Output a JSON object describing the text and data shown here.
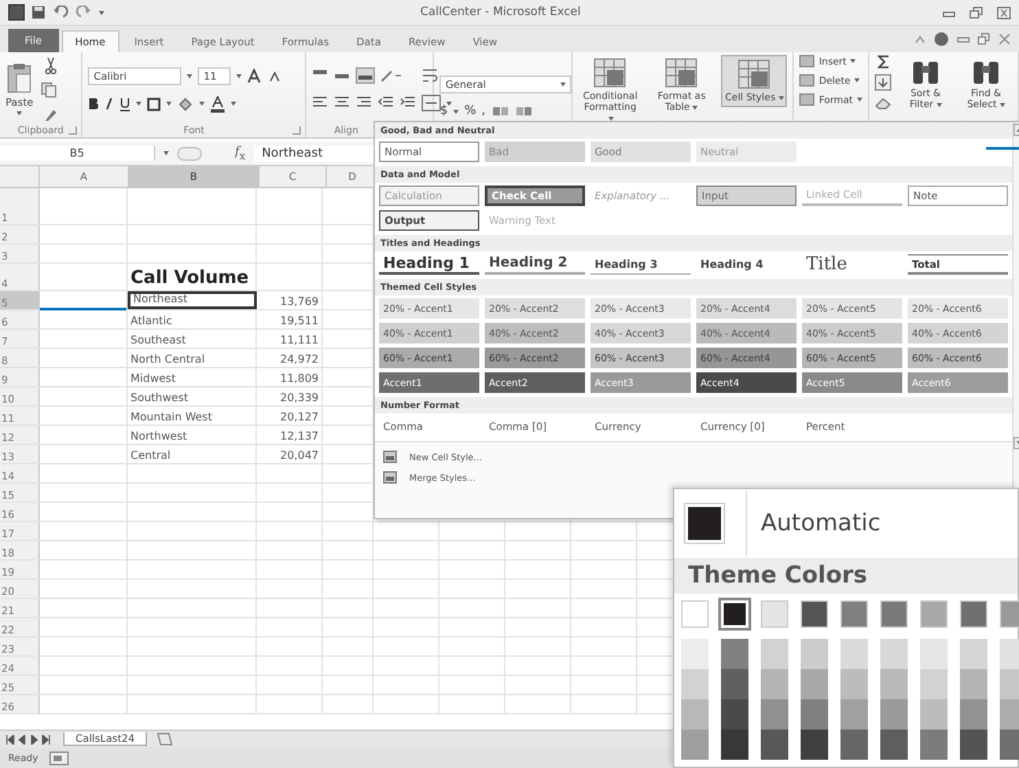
{
  "window": {
    "title": "CallCenter - Microsoft Excel"
  },
  "ribbon_tabs": [
    {
      "label": "File",
      "kind": "file",
      "selected": false
    },
    {
      "label": "Home",
      "kind": "tab",
      "selected": true
    },
    {
      "label": "Insert",
      "kind": "tab",
      "selected": false
    },
    {
      "label": "Page Layout",
      "kind": "tab",
      "selected": false
    },
    {
      "label": "Formulas",
      "kind": "tab",
      "selected": false
    },
    {
      "label": "Data",
      "kind": "tab",
      "selected": false
    },
    {
      "label": "Review",
      "kind": "tab",
      "selected": false
    },
    {
      "label": "View",
      "kind": "tab",
      "selected": false
    }
  ],
  "ribbon": {
    "clipboard": {
      "paste": "Paste",
      "label": "Clipboard"
    },
    "font": {
      "name": "Calibri",
      "size": "11",
      "label": "Font"
    },
    "alignment": {
      "label": "Align"
    },
    "number": {
      "format": "General",
      "symbols": [
        "$",
        "%",
        ","
      ]
    },
    "styles": [
      {
        "label": "Conditional Formatting",
        "selected": false
      },
      {
        "label": "Format as Table",
        "selected": false
      },
      {
        "label": "Cell Styles",
        "selected": true
      }
    ],
    "cells": [
      "Insert",
      "Delete",
      "Format"
    ],
    "editing": [
      "Sort & Filter",
      "Find & Select"
    ]
  },
  "formula_bar": {
    "name_box": "B5",
    "function_label": "*f*$_{x}$",
    "formula": "Northeast"
  },
  "sheet": {
    "columns": [
      {
        "label": "A",
        "selected": false
      },
      {
        "label": "B",
        "selected": true
      },
      {
        "label": "C",
        "selected": false
      },
      {
        "label": "D",
        "selected": false
      }
    ],
    "rows": [
      {
        "number": "1",
        "selected": false
      },
      {
        "number": "2",
        "selected": false
      },
      {
        "number": "3",
        "selected": false
      },
      {
        "number": "4",
        "kind": "title",
        "label": "Call Volume",
        "selected": false
      },
      {
        "number": "5",
        "label": "Northeast",
        "value": "13,769",
        "selected": true
      },
      {
        "number": "6",
        "label": "Atlantic",
        "value": "19,511",
        "selected": false
      },
      {
        "number": "7",
        "label": "Southeast",
        "value": "11,111",
        "selected": false
      },
      {
        "number": "8",
        "label": "North Central",
        "value": "24,972",
        "selected": false
      },
      {
        "number": "9",
        "label": "Midwest",
        "value": "11,809",
        "selected": false
      },
      {
        "number": "10",
        "label": "Southwest",
        "value": "20,339",
        "selected": false
      },
      {
        "number": "11",
        "label": "Mountain West",
        "value": "20,127",
        "selected": false
      },
      {
        "number": "12",
        "label": "Northwest",
        "value": "12,137",
        "selected": false
      },
      {
        "number": "13",
        "label": "Central",
        "value": "20,047",
        "selected": false
      },
      {
        "number": "14",
        "selected": false
      },
      {
        "number": "15",
        "selected": false
      },
      {
        "number": "16",
        "selected": false
      },
      {
        "number": "17",
        "selected": false
      },
      {
        "number": "18",
        "selected": false
      },
      {
        "number": "19",
        "selected": false
      },
      {
        "number": "20",
        "selected": false
      },
      {
        "number": "21",
        "selected": false
      },
      {
        "number": "22",
        "selected": false
      },
      {
        "number": "23",
        "selected": false
      },
      {
        "number": "24",
        "selected": false
      },
      {
        "number": "25",
        "selected": false
      },
      {
        "number": "26",
        "selected": false
      }
    ]
  },
  "sheet_tabs": [
    {
      "label": "CallsLast24",
      "selected": true
    }
  ],
  "status_bar": {
    "text": "Ready"
  },
  "cell_styles": {
    "sections": [
      {
        "title": "Good, Bad and Neutral",
        "items": [
          {
            "label": "Normal",
            "kind": "normal"
          },
          {
            "label": "Bad",
            "kind": "bad"
          },
          {
            "label": "Good",
            "kind": "good"
          },
          {
            "label": "Neutral",
            "kind": "neutral"
          }
        ]
      },
      {
        "title": "Data and Model",
        "items": [
          {
            "label": "Calculation",
            "kind": "calculation"
          },
          {
            "label": "Check Cell",
            "kind": "check"
          },
          {
            "label": "Explanatory ...",
            "kind": "explanatory"
          },
          {
            "label": "Input",
            "kind": "input"
          },
          {
            "label": "Linked Cell",
            "kind": "linked"
          },
          {
            "label": "Note",
            "kind": "note"
          },
          {
            "label": "Output",
            "kind": "output"
          },
          {
            "label": "Warning Text",
            "kind": "warning"
          }
        ]
      },
      {
        "title": "Titles and Headings",
        "items": [
          {
            "label": "Heading 1",
            "kind": "h1"
          },
          {
            "label": "Heading 2",
            "kind": "h2"
          },
          {
            "label": "Heading 3",
            "kind": "h3"
          },
          {
            "label": "Heading 4",
            "kind": "h4"
          },
          {
            "label": "Title",
            "kind": "title"
          },
          {
            "label": "Total",
            "kind": "total"
          }
        ]
      },
      {
        "title": "Themed Cell Styles",
        "items": [
          {
            "label": "20% - Accent1",
            "kind": "accent20",
            "color": "#e6e6e6"
          },
          {
            "label": "20% - Accent2",
            "kind": "accent20",
            "color": "#dedede"
          },
          {
            "label": "20% - Accent3",
            "kind": "accent20",
            "color": "#e9e9e9"
          },
          {
            "label": "20% - Accent4",
            "kind": "accent20",
            "color": "#dcdcdc"
          },
          {
            "label": "20% - Accent5",
            "kind": "accent20",
            "color": "#e4e4e4"
          },
          {
            "label": "20% - Accent6",
            "kind": "accent20",
            "color": "#e8e8e8"
          },
          {
            "label": "40% - Accent1",
            "kind": "accent40",
            "color": "#cfcfcf"
          },
          {
            "label": "40% - Accent2",
            "kind": "accent40",
            "color": "#bdbdbd"
          },
          {
            "label": "40% - Accent3",
            "kind": "accent40",
            "color": "#d8d8d8"
          },
          {
            "label": "40% - Accent4",
            "kind": "accent40",
            "color": "#bababa"
          },
          {
            "label": "40% - Accent5",
            "kind": "accent40",
            "color": "#cccccc"
          },
          {
            "label": "40% - Accent6",
            "kind": "accent40",
            "color": "#d4d4d4"
          },
          {
            "label": "60% - Accent1",
            "kind": "accent60",
            "color": "#ababab"
          },
          {
            "label": "60% - Accent2",
            "kind": "accent60",
            "color": "#9a9a9a"
          },
          {
            "label": "60% - Accent3",
            "kind": "accent60",
            "color": "#c4c4c4"
          },
          {
            "label": "60% - Accent4",
            "kind": "accent60",
            "color": "#969696"
          },
          {
            "label": "60% - Accent5",
            "kind": "accent60",
            "color": "#b4b4b4"
          },
          {
            "label": "60% - Accent6",
            "kind": "accent60",
            "color": "#bcbcbc"
          },
          {
            "label": "Accent1",
            "kind": "accent",
            "color": "#6e6e6e"
          },
          {
            "label": "Accent2",
            "kind": "accent",
            "color": "#5e5e5e"
          },
          {
            "label": "Accent3",
            "kind": "accent",
            "color": "#9a9a9a"
          },
          {
            "label": "Accent4",
            "kind": "accent",
            "color": "#4a4a4a"
          },
          {
            "label": "Accent5",
            "kind": "accent",
            "color": "#8a8a8a"
          },
          {
            "label": "Accent6",
            "kind": "accent",
            "color": "#9c9c9c"
          }
        ]
      },
      {
        "title": "Number Format",
        "items": [
          {
            "label": "Comma",
            "kind": "plain"
          },
          {
            "label": "Comma [0]",
            "kind": "plain"
          },
          {
            "label": "Currency",
            "kind": "plain"
          },
          {
            "label": "Currency [0]",
            "kind": "plain"
          },
          {
            "label": "Percent",
            "kind": "plain"
          }
        ]
      }
    ],
    "actions": [
      "New Cell Style...",
      "Merge Styles..."
    ]
  },
  "color_picker": {
    "automatic": "Automatic",
    "theme_title": "Theme Colors",
    "theme_colors": [
      {
        "color": "#ffffff",
        "selected": false,
        "shades": [
          {
            "color": "#ececec"
          },
          {
            "color": "#d2d2d2"
          },
          {
            "color": "#b8b8b8"
          },
          {
            "color": "#9e9e9e"
          }
        ]
      },
      {
        "color": "#231f20",
        "selected": true,
        "shades": [
          {
            "color": "#808080"
          },
          {
            "color": "#606060"
          },
          {
            "color": "#4a4a4a"
          },
          {
            "color": "#383838"
          }
        ]
      },
      {
        "color": "#e4e4e4",
        "selected": false,
        "shades": [
          {
            "color": "#d2d2d2"
          },
          {
            "color": "#b4b4b4"
          },
          {
            "color": "#909090"
          },
          {
            "color": "#585858"
          }
        ]
      },
      {
        "color": "#555555",
        "selected": false,
        "shades": [
          {
            "color": "#cccccc"
          },
          {
            "color": "#a8a8a8"
          },
          {
            "color": "#808080"
          },
          {
            "color": "#404040"
          }
        ]
      },
      {
        "color": "#808080",
        "selected": false,
        "shades": [
          {
            "color": "#dadada"
          },
          {
            "color": "#bcbcbc"
          },
          {
            "color": "#a0a0a0"
          },
          {
            "color": "#666666"
          }
        ]
      },
      {
        "color": "#7a7a7a",
        "selected": false,
        "shades": [
          {
            "color": "#d8d8d8"
          },
          {
            "color": "#b8b8b8"
          },
          {
            "color": "#9a9a9a"
          },
          {
            "color": "#5e5e5e"
          }
        ]
      },
      {
        "color": "#a8a8a8",
        "selected": false,
        "shades": [
          {
            "color": "#e6e6e6"
          },
          {
            "color": "#d2d2d2"
          },
          {
            "color": "#bcbcbc"
          },
          {
            "color": "#7c7c7c"
          }
        ]
      },
      {
        "color": "#707070",
        "selected": false,
        "shades": [
          {
            "color": "#d6d6d6"
          },
          {
            "color": "#b4b4b4"
          },
          {
            "color": "#929292"
          },
          {
            "color": "#545454"
          }
        ]
      },
      {
        "color": "#999999",
        "selected": false,
        "shades": [
          {
            "color": "#e0e0e0"
          },
          {
            "color": "#c6c6c6"
          },
          {
            "color": "#acacac"
          },
          {
            "color": "#707070"
          }
        ]
      }
    ]
  }
}
